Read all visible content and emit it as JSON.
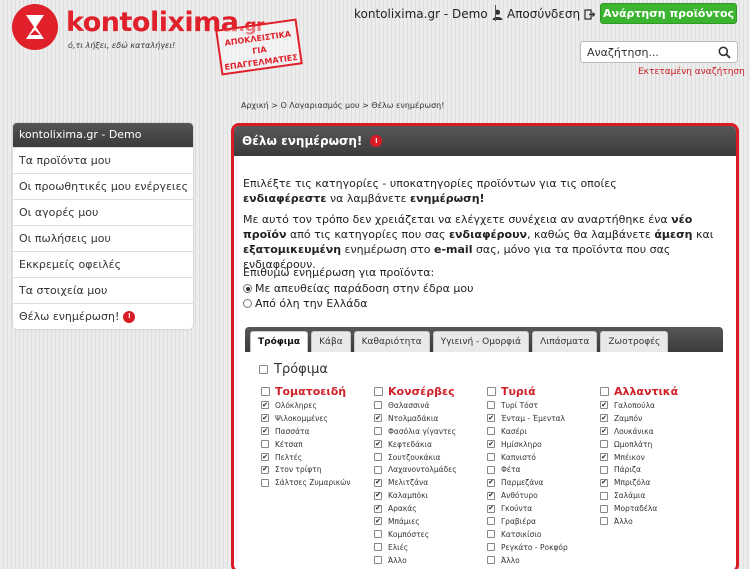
{
  "brand": {
    "logo_text": "kontolixima",
    "logo_tld": ".gr",
    "tagline": "ό,τι λήξει, εδώ καταλήγει!",
    "stamp": "ΑΠΟΚΛΕΙΣΤΙΚΑ ΓΙΑ ΕΠΑΓΓΕΛΜΑΤΙΕΣ"
  },
  "header": {
    "user_label": "kontolixima.gr - Demo",
    "logout_label": "Αποσύνδεση",
    "post_button": "Ανάρτηση προϊόντος",
    "search_placeholder": "Αναζήτηση...",
    "advanced_search": "Εκτεταμένη αναζήτηση"
  },
  "breadcrumb": "Αρχική > Ο Λογαριασμός μου > Θέλω ενημέρωση!",
  "sidebar": {
    "title": "kontolixima.gr - Demo",
    "items": [
      {
        "label": "Τα προϊόντα μου"
      },
      {
        "label": "Οι προωθητικές μου ενέργειες"
      },
      {
        "label": "Οι αγορές μου"
      },
      {
        "label": "Οι πωλήσεις μου"
      },
      {
        "label": "Εκκρεμείς οφειλές"
      },
      {
        "label": "Τα στοιχεία μου"
      },
      {
        "label": "Θέλω ενημέρωση!"
      }
    ]
  },
  "panel": {
    "title": "Θέλω ενημέρωση!",
    "intro_a": "Επιλέξτε τις κατηγορίες - υποκατηγορίες προϊόντων για τις οποίες ",
    "intro_a_bold": "ενδιαφέρεστε",
    "intro_a2": " να λαμβάνετε ",
    "intro_a2_bold": "ενημέρωση!",
    "intro_b1": "Με αυτό τον τρόπο δεν χρειάζεται να ελέγχετε συνέχεια αν αναρτήθηκε ένα ",
    "intro_b1_bold": "νέο προϊόν",
    "intro_b2": " από τις κατηγορίες που σας ",
    "intro_b2_bold": "ενδιαφέρουν",
    "intro_b3": ", καθώς θα λαμβάνετε ",
    "intro_b3_bold": "άμεση",
    "intro_b4": " και ",
    "intro_b4_bold": "εξατομικευμένη",
    "intro_b5": " ενημέρωση στο ",
    "intro_b5_bold": "e-mail",
    "intro_b6": " σας, μόνο για τα προϊόντα που σας ενδιαφέρουν.",
    "wish_label": "Επιθυμώ ενημέρωση για προϊόντα:",
    "radio_1": "Με απευθείας παράδοση στην έδρα μου",
    "radio_2": "Από όλη την Ελλάδα",
    "radio_selected": 1
  },
  "tabs": [
    {
      "label": "Τρόφιμα",
      "active": true
    },
    {
      "label": "Κάβα",
      "active": false
    },
    {
      "label": "Καθαριότητα",
      "active": false
    },
    {
      "label": "Υγιεινή - Ομορφιά",
      "active": false
    },
    {
      "label": "Λιπάσματα",
      "active": false
    },
    {
      "label": "Ζωοτροφές",
      "active": false
    }
  ],
  "food": {
    "title": "Τρόφιμα",
    "columns": [
      {
        "heading": "Τοματοειδή",
        "items": [
          {
            "label": "Ολόκληρες",
            "checked": true
          },
          {
            "label": "Ψιλοκομμένες",
            "checked": true
          },
          {
            "label": "Πασσάτα",
            "checked": true
          },
          {
            "label": "Κέτσαπ",
            "checked": false
          },
          {
            "label": "Πελτές",
            "checked": true
          },
          {
            "label": "Στον τρίφτη",
            "checked": true
          },
          {
            "label": "Σάλτσες Ζυμαρικών",
            "checked": false
          }
        ]
      },
      {
        "heading": "Κονσέρβες",
        "items": [
          {
            "label": "Θαλασσινά",
            "checked": false
          },
          {
            "label": "Ντολμαδάκια",
            "checked": true
          },
          {
            "label": "Φασόλια γίγαντες",
            "checked": false
          },
          {
            "label": "Κεφτεδάκια",
            "checked": true
          },
          {
            "label": "Σουτζουκάκια",
            "checked": false
          },
          {
            "label": "Λαχανοντολμάδες",
            "checked": false
          },
          {
            "label": "Μελιτζάνα",
            "checked": true
          },
          {
            "label": "Καλαμπόκι",
            "checked": true
          },
          {
            "label": "Αρακάς",
            "checked": true
          },
          {
            "label": "Μπάμιες",
            "checked": true
          },
          {
            "label": "Κομπόστες",
            "checked": false
          },
          {
            "label": "Ελιές",
            "checked": false
          },
          {
            "label": "Άλλο",
            "checked": false
          }
        ]
      },
      {
        "heading": "Τυριά",
        "items": [
          {
            "label": "Τυρί Τόστ",
            "checked": false
          },
          {
            "label": "Ένταμ - Έμενταλ",
            "checked": true
          },
          {
            "label": "Κασέρι",
            "checked": false
          },
          {
            "label": "Ημίσκληρο",
            "checked": true
          },
          {
            "label": "Καπνιστό",
            "checked": false
          },
          {
            "label": "Φέτα",
            "checked": false
          },
          {
            "label": "Παρμεζάνα",
            "checked": true
          },
          {
            "label": "Ανθότυρο",
            "checked": true
          },
          {
            "label": "Γκούντα",
            "checked": true
          },
          {
            "label": "Γραβιέρα",
            "checked": false
          },
          {
            "label": "Κατσικίσιο",
            "checked": false
          },
          {
            "label": "Ρεγκάτο - Ροκφόρ",
            "checked": false
          },
          {
            "label": "Άλλο",
            "checked": false
          }
        ]
      },
      {
        "heading": "Αλλαντικά",
        "items": [
          {
            "label": "Γαλοπούλα",
            "checked": true
          },
          {
            "label": "Ζαμπόν",
            "checked": true
          },
          {
            "label": "Λουκάνικα",
            "checked": true
          },
          {
            "label": "Ωμοπλάτη",
            "checked": false
          },
          {
            "label": "Μπέικον",
            "checked": true
          },
          {
            "label": "Πάριζα",
            "checked": false
          },
          {
            "label": "Μπριζόλα",
            "checked": true
          },
          {
            "label": "Σαλάμια",
            "checked": false
          },
          {
            "label": "Μορταδέλα",
            "checked": false
          },
          {
            "label": "Άλλο",
            "checked": false
          }
        ]
      }
    ]
  },
  "colors": {
    "brand_red": "#e0202a",
    "green_button": "#3bb42f",
    "header_dark": "#3b3b3b"
  }
}
